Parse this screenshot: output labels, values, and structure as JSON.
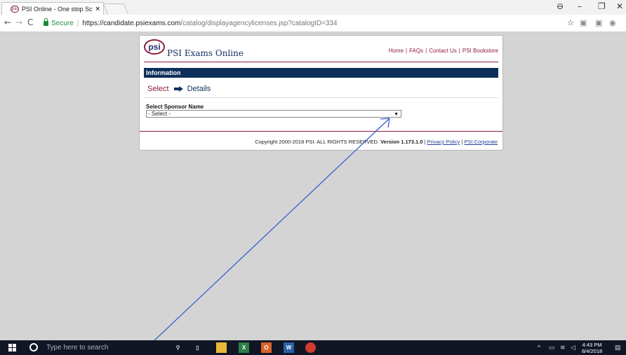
{
  "browser": {
    "tab_title": "PSI Online - One stop Sc",
    "tab_close": "×",
    "secure_label": "Secure",
    "url_host": "https://candidate.psiexams.com",
    "url_path": "/catalog/displayagencylicenses.jsp?catalogID=334",
    "minimize": "–",
    "maximize": "❐",
    "close": "✕",
    "account_icon": "⊖",
    "star_icon": "☆"
  },
  "site": {
    "logo_text": "psi",
    "brand": "PSI Exams Online",
    "nav": {
      "home": "Home",
      "faqs": "FAQs",
      "contact": "Contact Us",
      "bookstore": "PSI Bookstore"
    },
    "section_title": "Information",
    "steps": {
      "step1": "Select",
      "step2": "Details"
    },
    "form": {
      "label": "Select Sponsor Name",
      "selected": "- Select -"
    },
    "footer": {
      "copyright": "Copyright 2000-2018 PSI. ALL RIGHTS RESERVED.",
      "version": "Version 1.173.1.0",
      "privacy": "Privacy Policy",
      "corporate": "PSI Corporate"
    }
  },
  "taskbar": {
    "search_placeholder": "Type here to search",
    "time": "4:43 PM",
    "date": "8/4/2018"
  },
  "colors": {
    "brand_maroon": "#8c1c3c",
    "brand_navy": "#0d2f5a",
    "secure_green": "#1b8a3a",
    "annotation_blue": "#3a5fcd"
  }
}
